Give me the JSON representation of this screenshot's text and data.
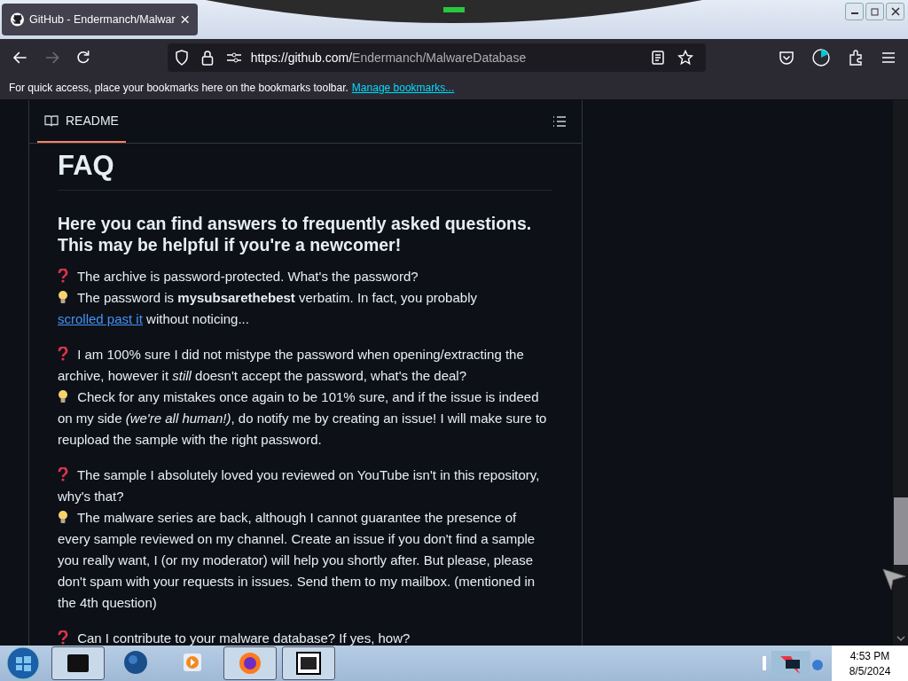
{
  "tab": {
    "title": "GitHub - Endermanch/Malwar",
    "selected": true
  },
  "address_bar": {
    "url_host": "https://github.com/",
    "url_path": "Endermanch/MalwareDatabase"
  },
  "bookmarks_bar": {
    "message": "For quick access, place your bookmarks here on the bookmarks toolbar.",
    "link": "Manage bookmarks..."
  },
  "readme": {
    "tab_label": "README",
    "heading": "FAQ",
    "intro": "Here you can find answers to frequently asked questions. This may be helpful if you're a newcomer!",
    "faq": [
      [
        {
          "kind": "question",
          "segments": [
            {
              "kind": "text",
              "text": "The archive is password-protected. What's the password?"
            }
          ]
        },
        {
          "kind": "answer",
          "segments": [
            {
              "kind": "text",
              "text": "The password is **mysubsarethebest** verbatim. In fact, you probably"
            },
            {
              "kind": "link",
              "text": "scrolled past it"
            },
            {
              "kind": "text",
              "text": "without noticing..."
            }
          ]
        }
      ],
      [
        {
          "kind": "question",
          "segments": [
            {
              "kind": "text",
              "text": "I am 100% sure I did not mistype the password when opening/extracting the archive, however it *still* doesn't accept the password, what's the deal?"
            }
          ]
        },
        {
          "kind": "answer",
          "segments": [
            {
              "kind": "text",
              "text": "Check for any mistakes once again to be 101% sure, and if the issue is indeed on my side *(we're all human!)*, do notify me by creating an issue! I will make sure to reupload the sample with the right password."
            }
          ]
        }
      ],
      [
        {
          "kind": "question",
          "segments": [
            {
              "kind": "text",
              "text": "The sample I absolutely loved you reviewed on YouTube isn't in this repository, why's that?"
            }
          ]
        },
        {
          "kind": "answer",
          "segments": [
            {
              "kind": "text",
              "text": "The malware series are back, although I cannot guarantee the presence of every sample reviewed on my channel. Create an issue if you don't find a sample you really want, I (or my moderator) will help you shortly after. But please, please don't spam with your requests in issues. Send them to my mailbox. (mentioned in the 4th question)"
            }
          ]
        }
      ],
      [
        {
          "kind": "question",
          "segments": [
            {
              "kind": "text",
              "text": "Can I contribute to your malware database? If yes, how?"
            }
          ]
        }
      ]
    ]
  },
  "taskbar": {
    "time": "4:53 PM",
    "date": "8/5/2024"
  }
}
